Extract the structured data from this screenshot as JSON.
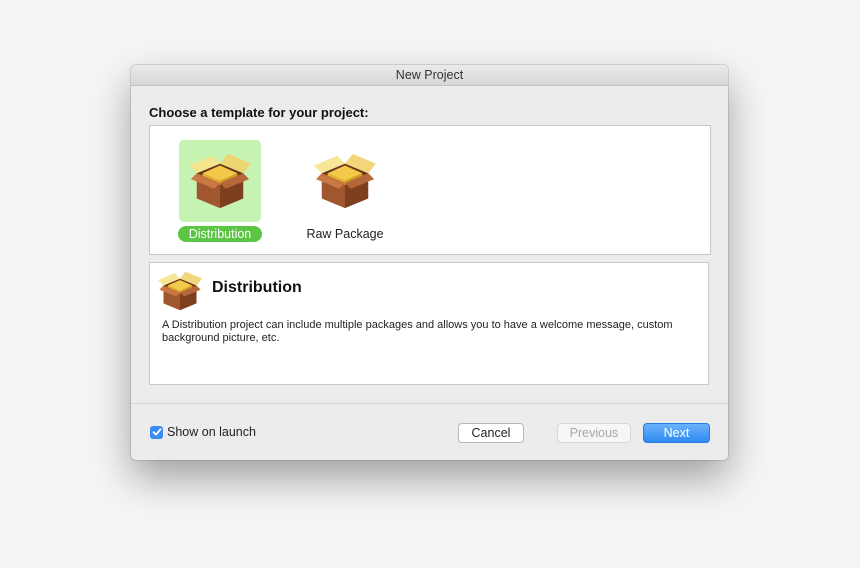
{
  "window": {
    "title": "New Project"
  },
  "chooser": {
    "heading": "Choose a template for your project:",
    "templates": [
      {
        "label": "Distribution",
        "icon": "package-box-icon",
        "selected": true
      },
      {
        "label": "Raw Package",
        "icon": "package-box-icon",
        "selected": false
      }
    ]
  },
  "description": {
    "title": "Distribution",
    "icon": "package-box-icon",
    "text": "A Distribution project can include multiple packages and allows you to have a welcome message, custom background picture, etc."
  },
  "footer": {
    "show_on_launch_label": "Show on launch",
    "show_on_launch_checked": true,
    "cancel_label": "Cancel",
    "previous_label": "Previous",
    "next_label": "Next"
  },
  "colors": {
    "selection_bg": "#c6f3b2",
    "selection_label": "#5cc544",
    "accent": "#3b8cf2"
  }
}
